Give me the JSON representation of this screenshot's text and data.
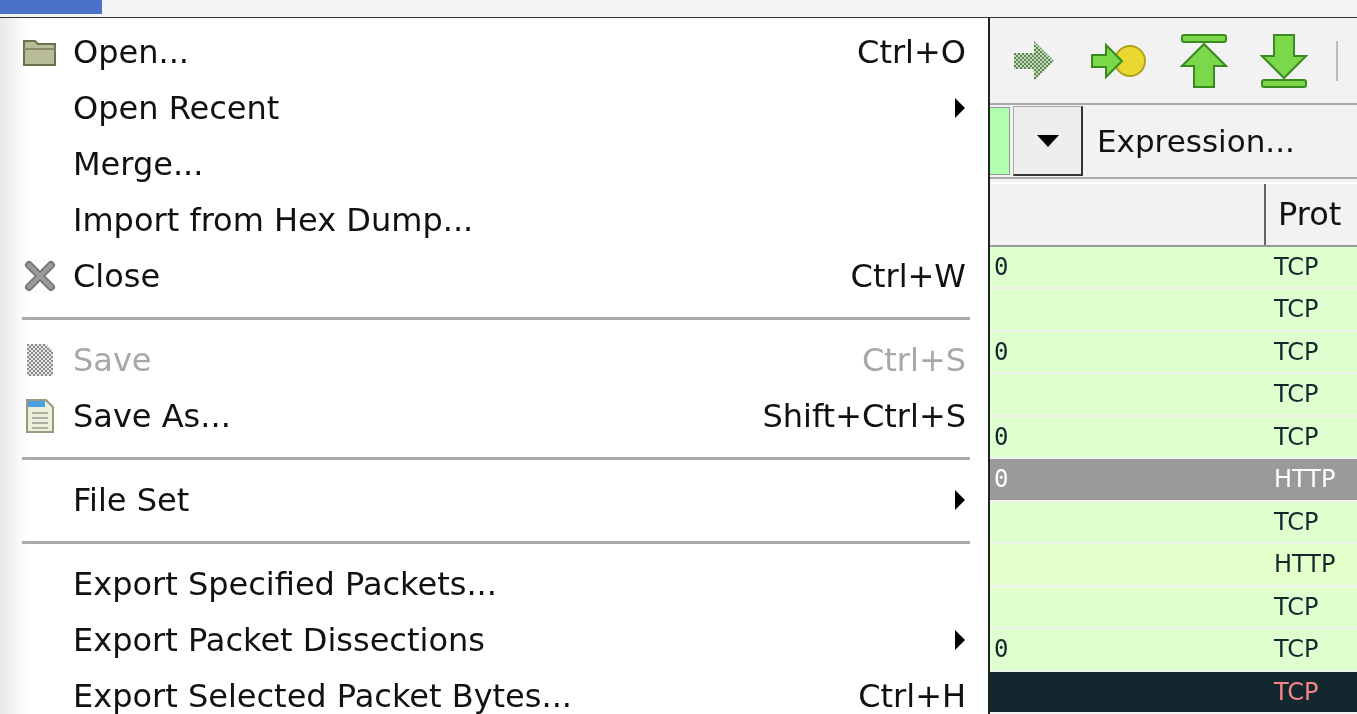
{
  "menu_bar": {
    "open_menu_highlighted": true
  },
  "file_menu": {
    "items": [
      {
        "kind": "item",
        "label": "Open...",
        "shortcut": "Ctrl+O",
        "disabled": false,
        "submenu": false
      },
      {
        "kind": "item",
        "label": "Open Recent",
        "disabled": false,
        "submenu": true
      },
      {
        "kind": "item",
        "label": "Merge...",
        "disabled": false,
        "submenu": false
      },
      {
        "kind": "item",
        "label": "Import from Hex Dump...",
        "disabled": false,
        "submenu": false
      },
      {
        "kind": "item",
        "label": "Close",
        "shortcut": "Ctrl+W",
        "disabled": false,
        "submenu": false
      },
      {
        "kind": "separator"
      },
      {
        "kind": "item",
        "label": "Save",
        "shortcut": "Ctrl+S",
        "disabled": true,
        "submenu": false
      },
      {
        "kind": "item",
        "label": "Save As...",
        "shortcut": "Shift+Ctrl+S",
        "disabled": false,
        "submenu": false
      },
      {
        "kind": "separator"
      },
      {
        "kind": "item",
        "label": "File Set",
        "disabled": false,
        "submenu": true
      },
      {
        "kind": "separator"
      },
      {
        "kind": "item",
        "label": "Export Specified Packets...",
        "disabled": false,
        "submenu": false
      },
      {
        "kind": "item",
        "label": "Export Packet Dissections",
        "disabled": false,
        "submenu": true
      },
      {
        "kind": "item",
        "label": "Export Selected Packet Bytes...",
        "shortcut": "Ctrl+H",
        "disabled": false,
        "submenu": false
      }
    ]
  },
  "toolbar": [
    {
      "kind": "goto",
      "disabled": true
    },
    {
      "kind": "goto_marked",
      "disabled": false
    },
    {
      "kind": "first",
      "disabled": false
    },
    {
      "kind": "last",
      "disabled": false
    }
  ],
  "filter": {
    "valid": true,
    "expression_button": "Expression..."
  },
  "packet_list": {
    "protocol_header": "Prot",
    "rows": [
      {
        "column_1": "0",
        "protocol": "TCP",
        "kind": "normal",
        "color": "#e0ffce",
        "selected": false
      },
      {
        "protocol": "TCP",
        "kind": "normal",
        "color": "#e0ffce",
        "selected": false
      },
      {
        "column_1": "0",
        "protocol": "TCP",
        "kind": "normal",
        "color": "#e0ffce",
        "selected": false
      },
      {
        "protocol": "TCP",
        "kind": "normal",
        "color": "#e0ffce",
        "selected": false
      },
      {
        "column_1": "0",
        "protocol": "TCP",
        "kind": "normal",
        "color": "#e0ffce",
        "selected": false
      },
      {
        "column_1": "0",
        "protocol": "HTTP",
        "selected": true
      },
      {
        "protocol": "TCP",
        "kind": "normal",
        "color": "#e0ffce",
        "selected": false
      },
      {
        "protocol": "HTTP",
        "kind": "normal",
        "color": "#e4ffc7",
        "selected": false
      },
      {
        "protocol": "TCP",
        "kind": "normal",
        "color": "#e0ffce",
        "selected": false
      },
      {
        "column_1": "0",
        "protocol": "TCP",
        "kind": "normal",
        "color": "#e0ffce",
        "selected": false
      },
      {
        "protocol": "TCP",
        "kind": "bad",
        "color": "#12272e",
        "selected": false
      }
    ]
  }
}
